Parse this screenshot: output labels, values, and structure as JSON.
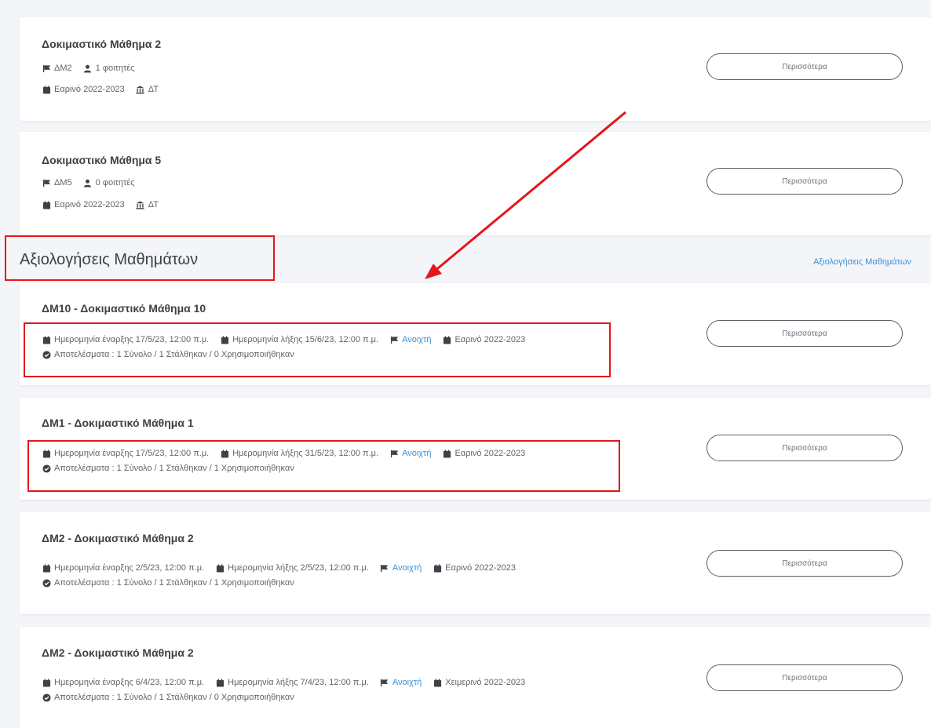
{
  "accent_color": "#3d8fd1",
  "annotation_color": "#e3161b",
  "courses": [
    {
      "title": "Δοκιμαστικό Μάθημα 2",
      "code": "ΔΜ2",
      "students": "1 φοιτητές",
      "semester": "Εαρινό 2022-2023",
      "department": "ΔΤ",
      "button": "Περισσότερα"
    },
    {
      "title": "Δοκιμαστικό Μάθημα 5",
      "code": "ΔΜ5",
      "students": "0 φοιτητές",
      "semester": "Εαρινό 2022-2023",
      "department": "ΔΤ",
      "button": "Περισσότερα"
    }
  ],
  "evaluations_section": {
    "title": "Αξιολογήσεις Μαθημάτων",
    "link": "Αξιολογήσεις Μαθημάτων"
  },
  "evaluations": [
    {
      "title": "ΔΜ10 - Δοκιμαστικό Μάθημα 10",
      "start": "Ημερομηνία έναρξης 17/5/23, 12:00 π.μ.",
      "end": "Ημερομηνία λήξης 15/6/23, 12:00 π.μ.",
      "status": "Ανοιχτή",
      "semester": "Εαρινό 2022-2023",
      "results": "Αποτελέσματα : 1 Σύνολο / 1 Στάλθηκαν / 0 Χρησιμοποιήθηκαν",
      "button": "Περισσότερα"
    },
    {
      "title": "ΔΜ1 - Δοκιμαστικό Μάθημα 1",
      "start": "Ημερομηνία έναρξης 17/5/23, 12:00 π.μ.",
      "end": "Ημερομηνία λήξης 31/5/23, 12:00 π.μ.",
      "status": "Ανοιχτή",
      "semester": "Εαρινό 2022-2023",
      "results": "Αποτελέσματα : 1 Σύνολο / 1 Στάλθηκαν / 1 Χρησιμοποιήθηκαν",
      "button": "Περισσότερα"
    },
    {
      "title": "ΔΜ2 - Δοκιμαστικό Μάθημα 2",
      "start": "Ημερομηνία έναρξης 2/5/23, 12:00 π.μ.",
      "end": "Ημερομηνία λήξης 2/5/23, 12:00 π.μ.",
      "status": "Ανοιχτή",
      "semester": "Εαρινό 2022-2023",
      "results": "Αποτελέσματα : 1 Σύνολο / 1 Στάλθηκαν / 1 Χρησιμοποιήθηκαν",
      "button": "Περισσότερα"
    },
    {
      "title": "ΔΜ2 - Δοκιμαστικό Μάθημα 2",
      "start": "Ημερομηνία έναρξης 6/4/23, 12:00 π.μ.",
      "end": "Ημερομηνία λήξης 7/4/23, 12:00 π.μ.",
      "status": "Ανοιχτή",
      "semester": "Χειμερινό 2022-2023",
      "results": "Αποτελέσματα : 1 Σύνολο / 1 Στάλθηκαν / 0 Χρησιμοποιήθηκαν",
      "button": "Περισσότερα"
    }
  ]
}
